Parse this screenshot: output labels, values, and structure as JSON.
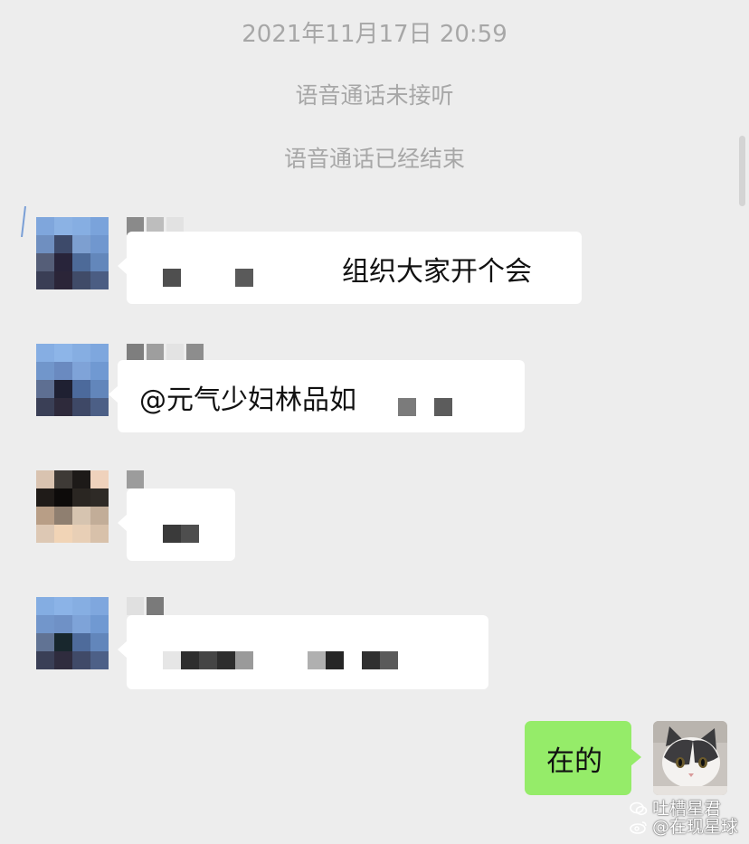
{
  "system_messages": {
    "timestamp": "2021年11月17日 20:59",
    "missed_call": "语音通话未接听",
    "call_ended": "语音通话已经结束"
  },
  "messages": [
    {
      "visible_text": "组织大家开个会",
      "redacted": true
    },
    {
      "visible_text": "@元气少妇林品如",
      "redacted": true
    },
    {
      "visible_text": "",
      "redacted": true
    },
    {
      "visible_text": "",
      "redacted": true
    },
    {
      "visible_text": "在的",
      "from_me": true
    }
  ],
  "watermark": {
    "line1": "吐槽星君",
    "line2": "@在现星球"
  },
  "icons": {
    "cat_avatar": "cat-photo-icon",
    "wechat_watermark": "wechat-icon",
    "weibo_watermark": "weibo-icon"
  },
  "colors": {
    "background": "#ededed",
    "incoming_bubble": "#ffffff",
    "outgoing_bubble": "#95ec69",
    "system_text": "#a7a7a7"
  }
}
